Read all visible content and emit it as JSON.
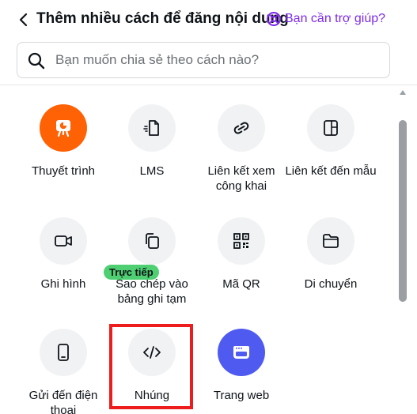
{
  "header": {
    "title": "Thêm nhiều cách để đăng nội dung",
    "help_label": "Bạn cần trợ giúp?"
  },
  "search": {
    "placeholder": "Bạn muốn chia sẻ theo cách nào?",
    "value": ""
  },
  "options": [
    {
      "label": "Thuyết trình",
      "icon": "presentation-icon",
      "accent": "#ff6105"
    },
    {
      "label": "LMS",
      "icon": "lms-icon"
    },
    {
      "label": "Liên kết xem công khai",
      "icon": "link-icon"
    },
    {
      "label": "Liên kết đến mẫu",
      "icon": "template-link-icon"
    },
    {
      "label": "Ghi hình",
      "icon": "record-video-icon"
    },
    {
      "label": "Sao chép vào bảng ghi tạm",
      "icon": "copy-icon"
    },
    {
      "label": "Mã QR",
      "icon": "qr-code-icon"
    },
    {
      "label": "Di chuyển",
      "icon": "folder-icon"
    },
    {
      "label": "Gửi đến điện thoại",
      "icon": "phone-icon"
    },
    {
      "label": "Nhúng",
      "icon": "embed-code-icon",
      "badge": "Trực tiếp"
    },
    {
      "label": "Trang web",
      "icon": "website-icon",
      "accent": "#4f5bf0"
    }
  ],
  "colors": {
    "highlight": "#ee1d1d",
    "badge": "#4ecf71",
    "help_link": "#7d2ae8"
  }
}
